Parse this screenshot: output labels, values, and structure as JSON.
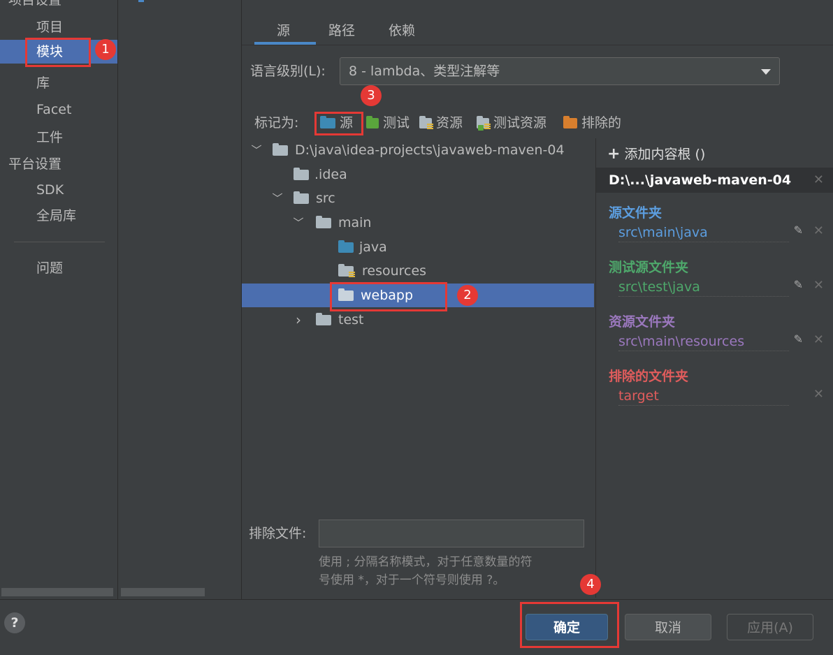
{
  "nav": {
    "project_settings_header": "项目设置",
    "project_settings_items": [
      "项目",
      "模块",
      "库",
      "Facet",
      "工件"
    ],
    "platform_settings_header": "平台设置",
    "platform_settings_items": [
      "SDK",
      "全局库"
    ],
    "problems": "问题",
    "selected": "模块"
  },
  "tabs": [
    "源",
    "路径",
    "依赖"
  ],
  "active_tab": "源",
  "language_level": {
    "label": "语言级别(L):",
    "value": "8 - lambda、类型注解等"
  },
  "mark_as": {
    "label": "标记为:",
    "options": [
      "源",
      "测试",
      "资源",
      "测试资源",
      "排除的"
    ]
  },
  "tree": {
    "root": "D:\\java\\idea-projects\\javaweb-maven-04",
    "idea": ".idea",
    "src": "src",
    "main": "main",
    "java": "java",
    "resources": "resources",
    "webapp": "webapp",
    "test": "test",
    "selected": "webapp"
  },
  "content_root": {
    "add_label": "添加内容根 ()",
    "root_path": "D:\\...\\javaweb-maven-04",
    "categories": [
      {
        "title": "源文件夹",
        "path": "src\\main\\java",
        "color": "#5c9ee0"
      },
      {
        "title": "测试源文件夹",
        "path": "src\\test\\java",
        "color": "#4ea86b"
      },
      {
        "title": "资源文件夹",
        "path": "src\\main\\resources",
        "color": "#9b78be"
      },
      {
        "title": "排除的文件夹",
        "path": "target",
        "color": "#e05c5c"
      }
    ]
  },
  "exclude_files": {
    "label": "排除文件:",
    "value": "",
    "help_line1": "使用 ; 分隔名称模式，对于任意数量的符",
    "help_line2": "号使用 *，对于一个符号则使用 ?。"
  },
  "buttons": {
    "help": "?",
    "ok": "确定",
    "cancel": "取消",
    "apply": "应用(A)"
  },
  "annotations": [
    "1",
    "2",
    "3",
    "4"
  ],
  "colors": {
    "selection": "#4b6eaf",
    "annotation_red": "#e53935",
    "tab_accent": "#4a88c7"
  }
}
